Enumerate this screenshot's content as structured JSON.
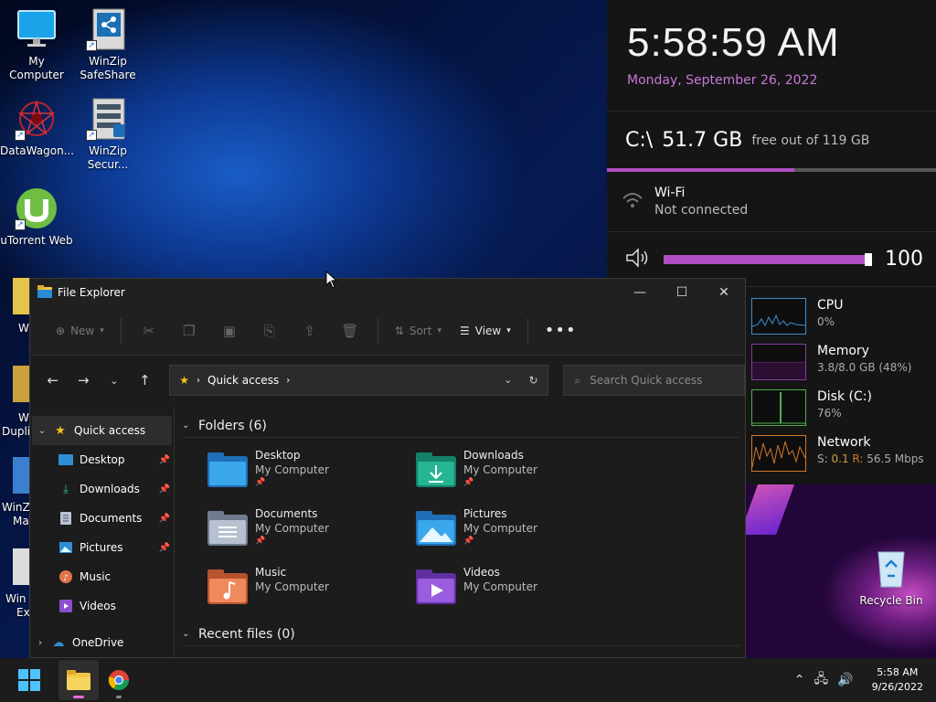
{
  "desktop": {
    "icons": [
      {
        "label": "My Computer"
      },
      {
        "label": "WinZip\nSafeShare"
      },
      {
        "label": "DataWagon..."
      },
      {
        "label": "WinZip\nSecur..."
      },
      {
        "label": "uTorrent Web"
      },
      {
        "label": "Recycle Bin"
      }
    ],
    "partial_labels": [
      "W",
      "Wi",
      "Dupli",
      "WinZi",
      "Ma",
      "Win",
      "Ex"
    ]
  },
  "widgets": {
    "time": "5:58:59 AM",
    "date": "Monday, September 26, 2022",
    "disk": {
      "drive": "C:\\",
      "free": "51.7 GB",
      "of_text": "free out of 119 GB",
      "used_fraction": 0.57
    },
    "wifi": {
      "name": "Wi-Fi",
      "status": "Not connected"
    },
    "volume": {
      "level": 100,
      "label": "100"
    },
    "perf": [
      {
        "name": "CPU",
        "value": "0%",
        "color": "#3d8fd1"
      },
      {
        "name": "Memory",
        "value": "3.8/8.0 GB (48%)",
        "color": "#8a3a9e"
      },
      {
        "name": "Disk (C:)",
        "value": "76%",
        "color": "#4caf50"
      },
      {
        "name": "Network",
        "s_label": "S:",
        "s_value": "0.1",
        "r_label": "R:",
        "r_value": "56.5 Mbps",
        "color": "#d0782a"
      }
    ]
  },
  "explorer": {
    "title": "File Explorer",
    "toolbar": {
      "new_label": "New",
      "sort_label": "Sort",
      "view_label": "View"
    },
    "address": {
      "path": "Quick access"
    },
    "search": {
      "placeholder": "Search Quick access"
    },
    "sidebar": [
      {
        "label": "Quick access"
      },
      {
        "label": "Desktop"
      },
      {
        "label": "Downloads"
      },
      {
        "label": "Documents"
      },
      {
        "label": "Pictures"
      },
      {
        "label": "Music"
      },
      {
        "label": "Videos"
      },
      {
        "label": "OneDrive"
      }
    ],
    "sections": {
      "folders": "Folders (6)",
      "recent": "Recent files (0)"
    },
    "folders": [
      {
        "name": "Desktop",
        "location": "My Computer",
        "pinned": true,
        "color": "#2f8fd6"
      },
      {
        "name": "Downloads",
        "location": "My Computer",
        "pinned": true,
        "color": "#1fa58a"
      },
      {
        "name": "Documents",
        "location": "My Computer",
        "pinned": true,
        "color": "#9aa6b8"
      },
      {
        "name": "Pictures",
        "location": "My Computer",
        "pinned": true,
        "color": "#2f8fd6"
      },
      {
        "name": "Music",
        "location": "My Computer",
        "pinned": false,
        "color": "#e0744a"
      },
      {
        "name": "Videos",
        "location": "My Computer",
        "pinned": false,
        "color": "#8c4fd0"
      }
    ]
  },
  "taskbar": {
    "clock_time": "5:58 AM",
    "clock_date": "9/26/2022"
  }
}
